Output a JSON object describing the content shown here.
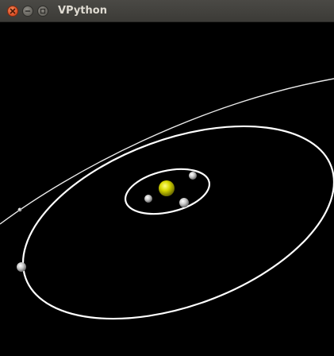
{
  "window": {
    "title": "VPython",
    "buttons": {
      "close_icon": "close-icon",
      "minimize_icon": "minimize-icon",
      "maximize_icon": "maximize-icon"
    }
  },
  "scene": {
    "background": "#000000",
    "sun_color": "#d8d800",
    "orbit_color": "#ffffff",
    "planet_color": "#c8c8c8"
  }
}
